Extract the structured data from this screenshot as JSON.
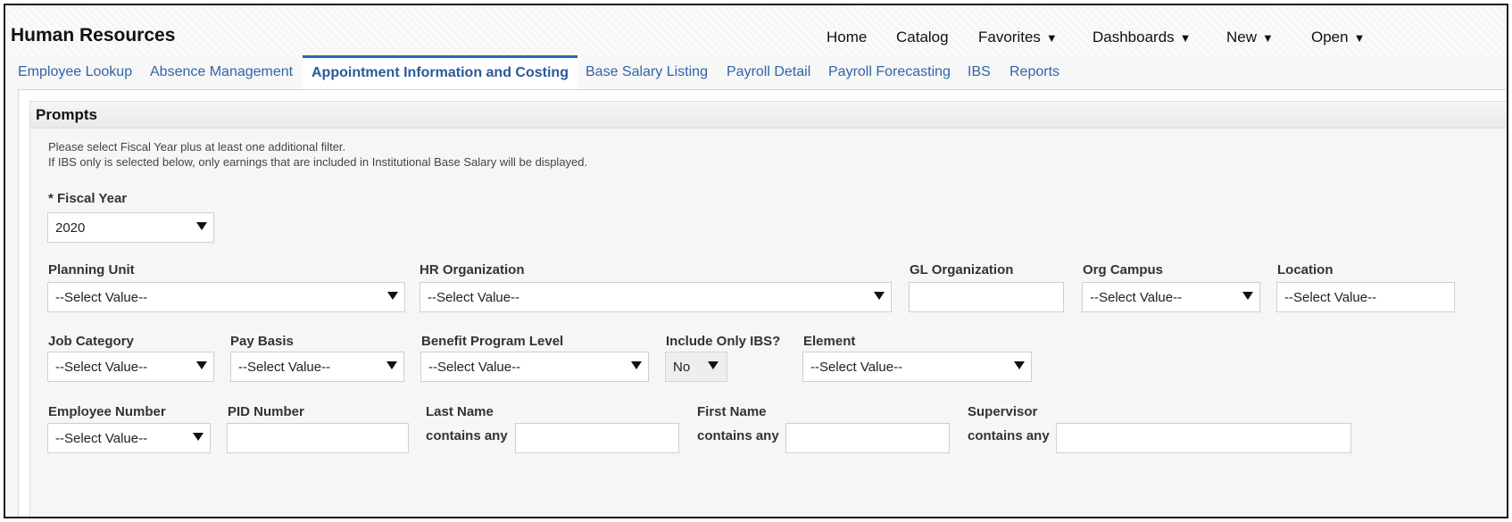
{
  "app": {
    "title": "Human Resources"
  },
  "topnav": {
    "items": [
      {
        "label": "Home"
      },
      {
        "label": "Catalog"
      },
      {
        "label": "Favorites",
        "caret": "▼"
      },
      {
        "label": "Dashboards",
        "caret": "▼"
      },
      {
        "label": "New",
        "caret": "▼"
      },
      {
        "label": "Open",
        "caret": "▼"
      }
    ]
  },
  "tabs": [
    {
      "label": "Employee Lookup"
    },
    {
      "label": "Absence Management"
    },
    {
      "label": "Appointment Information and Costing",
      "active": true
    },
    {
      "label": "Base Salary Listing"
    },
    {
      "label": "Payroll Detail"
    },
    {
      "label": "Payroll Forecasting"
    },
    {
      "label": "IBS"
    },
    {
      "label": "Reports"
    }
  ],
  "prompts": {
    "title": "Prompts",
    "note1": "Please select Fiscal Year plus at least one additional filter.",
    "note2": "If IBS only is selected below, only earnings that are included in Institutional Base Salary will be displayed.",
    "fiscal_year": {
      "label": "* Fiscal Year",
      "value": "2020"
    },
    "planning_unit": {
      "label": "Planning Unit",
      "value": "--Select Value--"
    },
    "hr_org": {
      "label": "HR Organization",
      "value": "--Select Value--"
    },
    "gl_org": {
      "label": "GL Organization",
      "value": ""
    },
    "org_campus": {
      "label": "Org Campus",
      "value": "--Select Value--"
    },
    "location": {
      "label": "Location",
      "value": "--Select Value--"
    },
    "job_category": {
      "label": "Job Category",
      "value": "--Select Value--"
    },
    "pay_basis": {
      "label": "Pay Basis",
      "value": "--Select Value--"
    },
    "benefit_level": {
      "label": "Benefit Program Level",
      "value": "--Select Value--"
    },
    "include_ibs": {
      "label": "Include Only IBS?",
      "value": "No"
    },
    "element": {
      "label": "Element",
      "value": "--Select Value--"
    },
    "employee_number": {
      "label": "Employee Number",
      "value": "--Select Value--"
    },
    "pid_number": {
      "label": "PID Number",
      "value": ""
    },
    "last_name": {
      "label": "Last Name",
      "operator": "contains any",
      "value": ""
    },
    "first_name": {
      "label": "First Name",
      "operator": "contains any",
      "value": ""
    },
    "supervisor": {
      "label": "Supervisor",
      "operator": "contains any",
      "value": ""
    }
  },
  "colors": {
    "tab_link": "#2f65a8",
    "tab_active_border": "#2b66b0",
    "frame": "#1a1a1a"
  }
}
